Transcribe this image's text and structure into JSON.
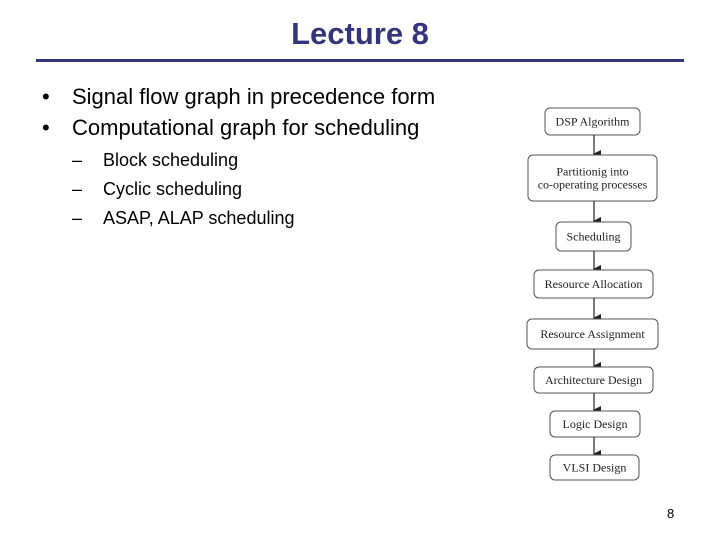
{
  "slide": {
    "title": "Lecture 8",
    "page_number": "8",
    "accent_color": "#333380"
  },
  "bullets": [
    {
      "marker": "•",
      "text": "Signal flow graph in precedence form"
    },
    {
      "marker": "•",
      "text": "Computational graph for scheduling"
    }
  ],
  "sub_bullets": [
    {
      "marker": "–",
      "text": "Block scheduling"
    },
    {
      "marker": "–",
      "text": "Cyclic scheduling"
    },
    {
      "marker": "–",
      "text": "ASAP, ALAP scheduling"
    }
  ],
  "flowchart": {
    "steps": [
      {
        "lines": [
          "DSP Algorithm"
        ]
      },
      {
        "lines": [
          "Partitionig into",
          "co-operating processes"
        ]
      },
      {
        "lines": [
          "Scheduling"
        ]
      },
      {
        "lines": [
          "Resource Allocation"
        ]
      },
      {
        "lines": [
          "Resource Assignment"
        ]
      },
      {
        "lines": [
          "Architecture Design"
        ]
      },
      {
        "lines": [
          "Logic Design"
        ]
      },
      {
        "lines": [
          "VLSI Design"
        ]
      }
    ]
  }
}
